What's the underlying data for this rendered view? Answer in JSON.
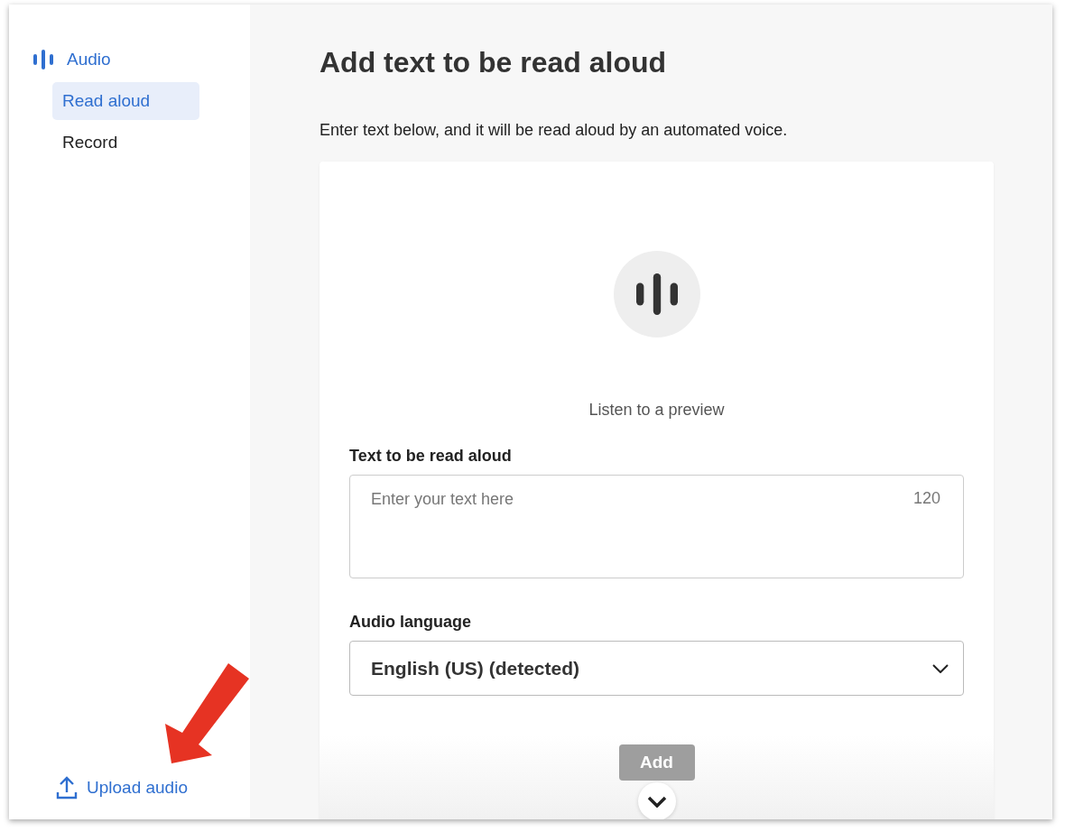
{
  "sidebar": {
    "section": {
      "label": "Audio"
    },
    "items": [
      {
        "label": "Read aloud",
        "selected": true
      },
      {
        "label": "Record",
        "selected": false
      }
    ],
    "upload": {
      "label": "Upload audio"
    }
  },
  "main": {
    "title": "Add text to be read aloud",
    "description": "Enter text below, and it will be read aloud by an automated voice.",
    "card": {
      "preview_label": "Listen to a preview",
      "text_field": {
        "label": "Text to be read aloud",
        "placeholder": "Enter your text here",
        "counter": "120"
      },
      "language": {
        "label": "Audio language",
        "value": "English (US) (detected)"
      },
      "add_button": {
        "label": "Add",
        "disabled": true
      }
    }
  }
}
